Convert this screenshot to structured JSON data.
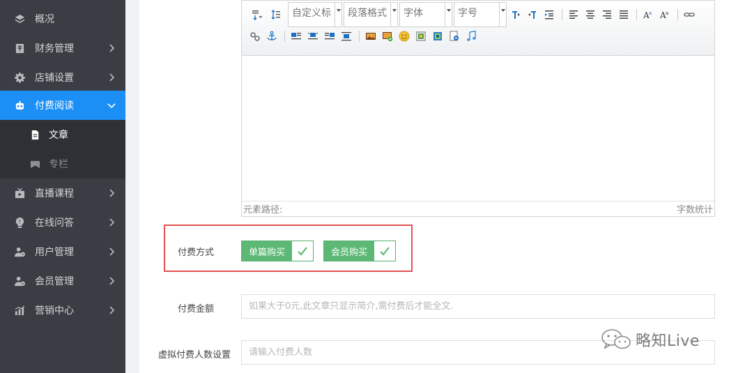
{
  "sidebar": {
    "items": [
      {
        "label": "概况",
        "icon": "layers-icon"
      },
      {
        "label": "财务管理",
        "icon": "finance-icon"
      },
      {
        "label": "店铺设置",
        "icon": "gear-icon"
      },
      {
        "label": "付费阅读",
        "icon": "robot-icon",
        "active": true
      },
      {
        "label": "直播课程",
        "icon": "tv-icon"
      },
      {
        "label": "在线问答",
        "icon": "question-icon"
      },
      {
        "label": "用户管理",
        "icon": "users-icon"
      },
      {
        "label": "会员管理",
        "icon": "member-icon"
      },
      {
        "label": "营销中心",
        "icon": "chart-icon"
      }
    ],
    "sub_items": [
      {
        "label": "文章",
        "icon": "document-icon"
      },
      {
        "label": "专栏",
        "icon": "column-icon"
      }
    ],
    "active_color": "#1b8ff5"
  },
  "editor": {
    "combos": [
      "自定义标",
      "段落格式",
      "字体",
      "字号"
    ],
    "status_left": "元素路径:",
    "status_right": "字数统计"
  },
  "form": {
    "pay_method_label": "付费方式",
    "pay_options": [
      "单篇购买",
      "会员购买"
    ],
    "amount_label": "付费金额",
    "amount_placeholder": "如果大于0元,此文章只显示简介,需付费后才能全文.",
    "virtual_label": "虚拟付费人数设置",
    "virtual_placeholder": "请输入付费人数"
  },
  "watermark": {
    "text": "略知Live"
  },
  "colors": {
    "highlight": "#e05252",
    "tag_green": "#5cb874"
  }
}
